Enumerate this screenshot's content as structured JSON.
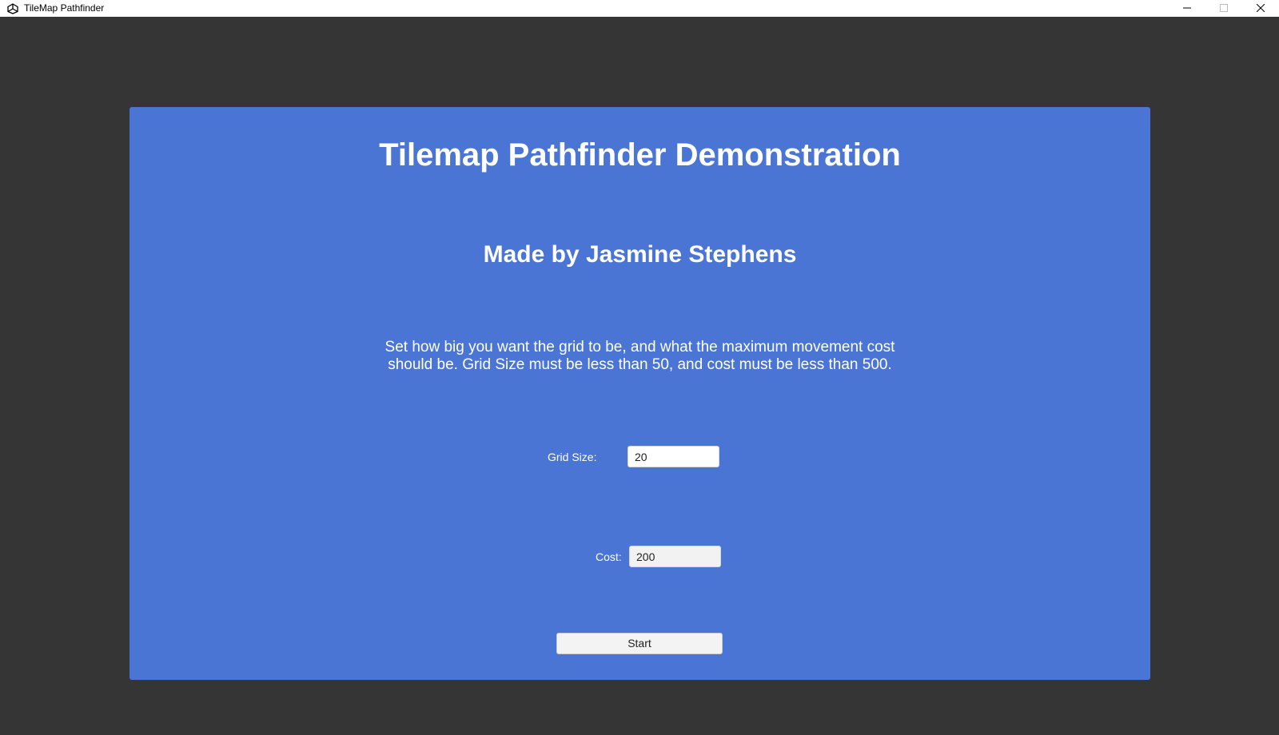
{
  "window": {
    "title": "TileMap Pathfinder",
    "app_icon": "unity-logo-icon",
    "controls": [
      "minimize-icon",
      "maximize-icon",
      "close-icon"
    ]
  },
  "menu": {
    "title": "Tilemap Pathfinder Demonstration",
    "subtitle": "Made by Jasmine Stephens",
    "instructions": "Set how big you want the grid to be, and what the maximum movement cost should be. Grid Size must be less than 50, and cost must be less than 500.",
    "grid_size": {
      "label": "Grid Size:",
      "value": "20"
    },
    "cost": {
      "label": "Cost:",
      "value": "200"
    },
    "start_label": "Start"
  },
  "colors": {
    "background": "#353535",
    "panel": "#4a75d5",
    "text": "#ffffff"
  }
}
